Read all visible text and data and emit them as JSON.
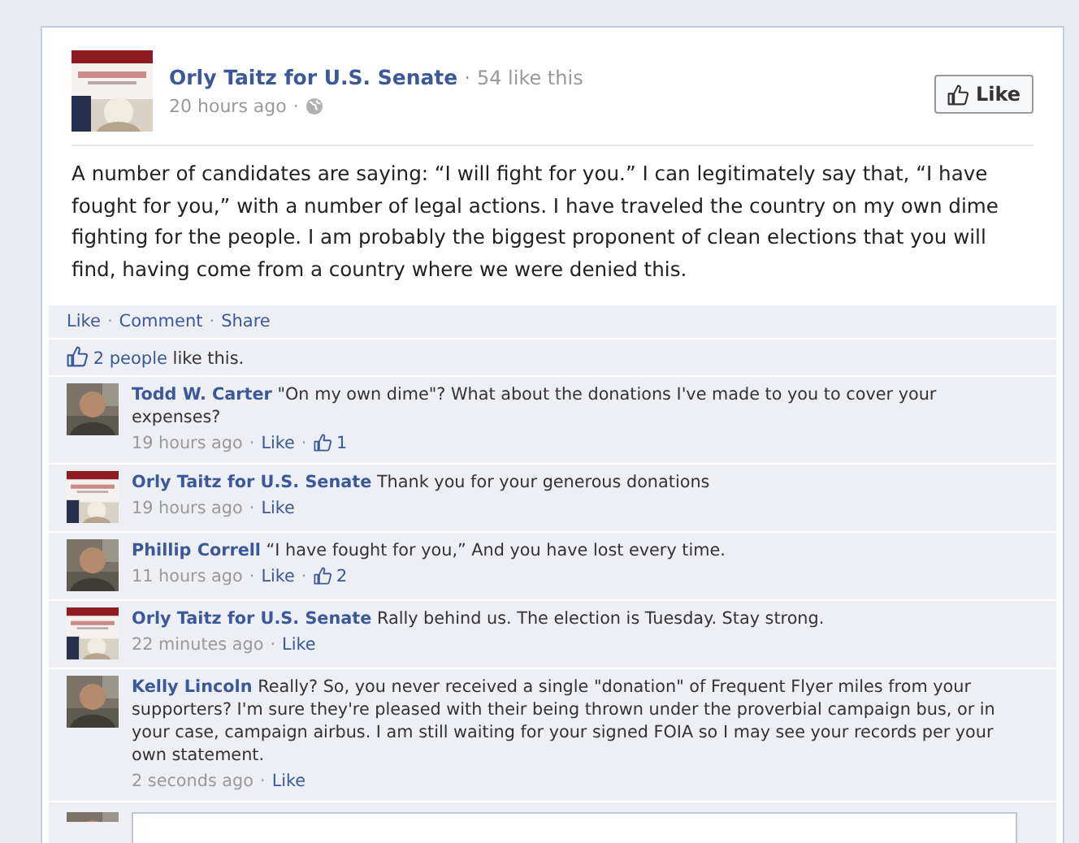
{
  "post": {
    "author": "Orly Taitz for U.S. Senate",
    "separator": "·",
    "likes_count": "54 like this",
    "time": "20 hours ago",
    "like_button": "Like",
    "text": "A number of candidates are saying: “I will fight for you.” I can legitimately say that, “I have fought for you,” with a number of legal actions. I have traveled the country on my own dime fighting for the people. I am probably the biggest proponent of clean elections that you will find, having come from a country where we were denied this."
  },
  "actions": [
    {
      "label": "Like"
    },
    {
      "label": "Comment"
    },
    {
      "label": "Share"
    }
  ],
  "likes_summary": {
    "link": "2 people",
    "text": "like this."
  },
  "comments": [
    {
      "kind": "person",
      "separator": "·",
      "author": "Todd W. Carter",
      "text": "\"On my own dime\"? What about the donations I've made to you to cover your expenses?",
      "time": "19 hours ago",
      "like": "Like",
      "like_count": "1"
    },
    {
      "kind": "page",
      "separator": "·",
      "author": "Orly Taitz for U.S. Senate",
      "text": "Thank you for your generous donations",
      "time": "19 hours ago",
      "like": "Like"
    },
    {
      "kind": "person",
      "separator": "·",
      "author": "Phillip Correll",
      "text": "“I have fought for you,” And you have lost every time.",
      "time": "11 hours ago",
      "like": "Like",
      "like_count": "2"
    },
    {
      "kind": "page",
      "separator": "·",
      "author": "Orly Taitz for U.S. Senate",
      "text": "Rally behind us. The election is Tuesday. Stay strong.",
      "time": "22 minutes ago",
      "like": "Like"
    },
    {
      "kind": "person",
      "separator": "·",
      "author": "Kelly Lincoln",
      "text": "Really? So, you never received a single \"donation\" of Frequent Flyer miles from your supporters? I'm sure they're pleased with their being thrown under the proverbial campaign bus, or in your case, campaign airbus. I am still waiting for your signed FOIA so I may see your records per your own statement.",
      "time": "2 seconds ago",
      "like": "Like"
    }
  ]
}
